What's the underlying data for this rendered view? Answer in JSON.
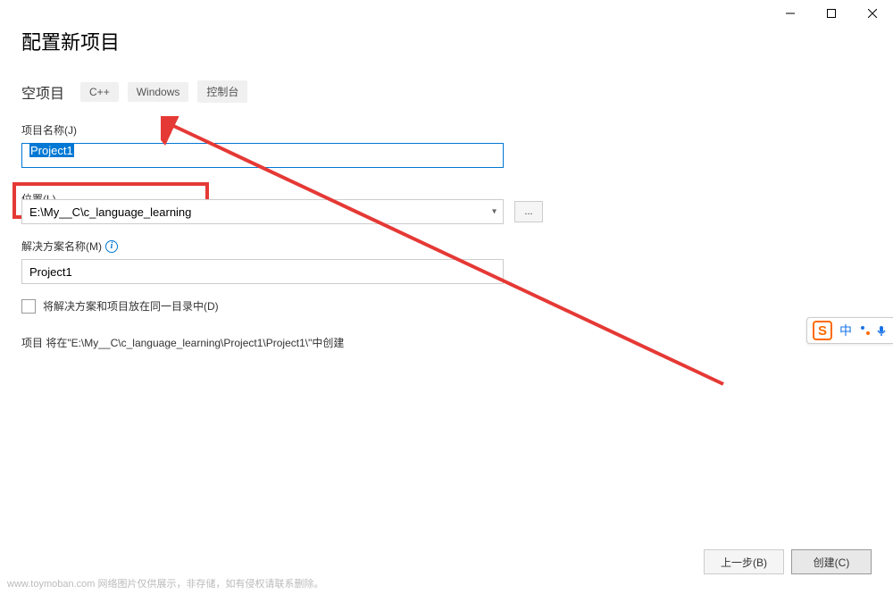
{
  "window": {
    "title": "配置新项目"
  },
  "subtitle": "空项目",
  "tags": [
    "C++",
    "Windows",
    "控制台"
  ],
  "fields": {
    "projectName": {
      "label": "项目名称(J)",
      "value": "Project1"
    },
    "location": {
      "label": "位置(L)",
      "value": "E:\\My__C\\c_language_learning",
      "browseLabel": "..."
    },
    "solutionName": {
      "label": "解决方案名称(M)",
      "value": "Project1"
    }
  },
  "checkbox": {
    "label": "将解决方案和项目放在同一目录中(D)",
    "checked": false
  },
  "summary": "项目 将在\"E:\\My__C\\c_language_learning\\Project1\\Project1\\\"中创建",
  "buttons": {
    "back": "上一步(B)",
    "create": "创建(C)"
  },
  "ime": {
    "logo": "S",
    "lang": "中"
  },
  "watermark": "www.toymoban.com 网络图片仅供展示，非存储，如有侵权请联系删除。"
}
